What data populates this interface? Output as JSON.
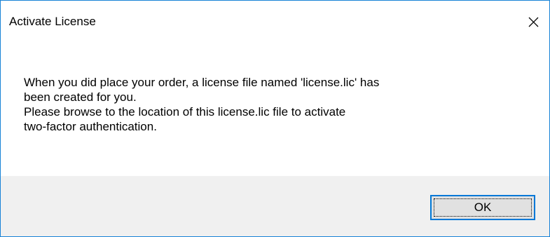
{
  "window": {
    "title": "Activate License"
  },
  "icons": {
    "close": "close-icon"
  },
  "message": {
    "lines": [
      "When you did place your order, a license file named 'license.lic' has",
      "been created for you.",
      "Please browse to the location of this license.lic file to activate",
      "two-factor authentication."
    ]
  },
  "buttons": {
    "ok_label": "OK"
  },
  "colors": {
    "window_border": "#1883d7",
    "footer_background": "#f0f0f0",
    "button_background": "#e1e1e1",
    "button_focus_border": "#0078d7"
  }
}
